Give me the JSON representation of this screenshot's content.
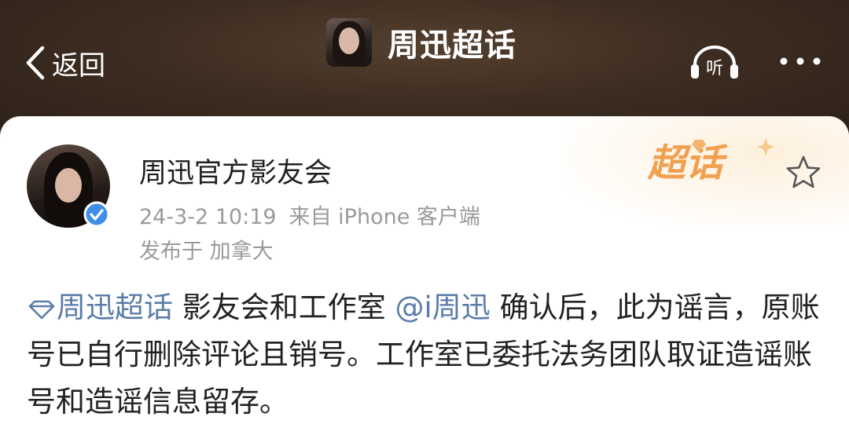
{
  "nav": {
    "back_label": "返回",
    "title": "周迅超话",
    "listen_label": "听",
    "icons": {
      "back": "chevron-left-icon",
      "listen": "headphones-icon",
      "more": "more-dots-icon"
    }
  },
  "post": {
    "author": "周迅官方影友会",
    "timestamp": "24-3-2 10:19",
    "source": "来自 iPhone 客户端",
    "location": "发布于 加拿大",
    "badge_label": "超话",
    "icons": {
      "verified": "verified-badge-icon",
      "favorite": "star-icon",
      "topic": "diamond-topic-icon"
    },
    "content": {
      "topic_link": "周迅超话",
      "text_1": " 影友会和工作室 ",
      "mention": "@i周迅",
      "text_2": " 确认后，此为谣言，原账号已自行删除评论且销号。工作室已委托法务团队取证造谣账号和造谣信息留存。"
    }
  },
  "colors": {
    "header_bg": "#3e2d21",
    "link": "#5a7ca8",
    "badge": "#f0a050",
    "verified": "#3f8ee8",
    "meta_text": "#9a9a9a"
  }
}
